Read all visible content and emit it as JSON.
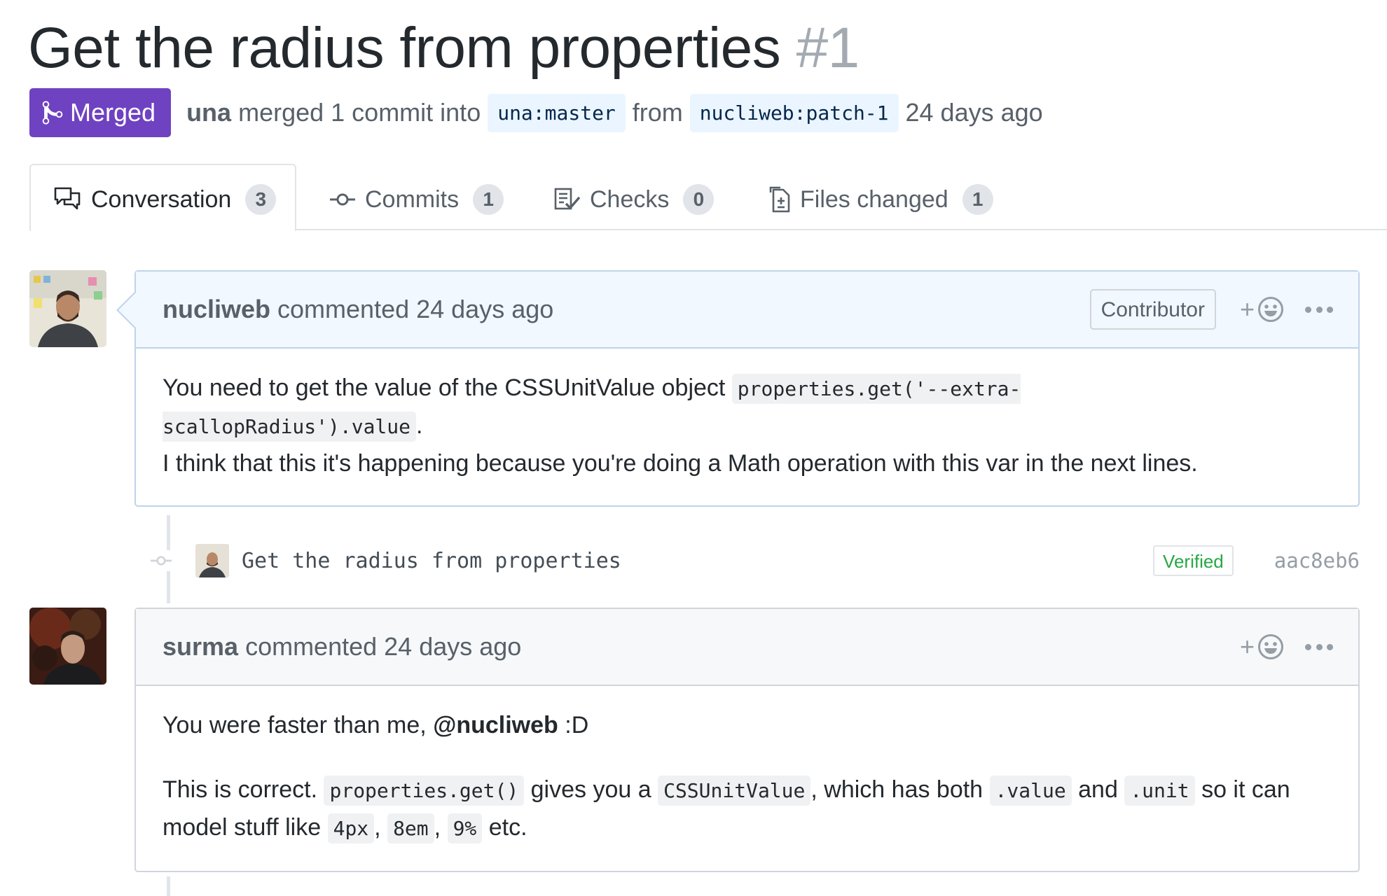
{
  "pr": {
    "title": "Get the radius from properties",
    "number": "#1",
    "state": "Merged",
    "author": "una",
    "action_text": "merged 1 commit into",
    "base_branch": "una:master",
    "from_text": "from",
    "head_branch": "nucliweb:patch-1",
    "time": "24 days ago"
  },
  "tabs": [
    {
      "label": "Conversation",
      "count": "3",
      "icon": "comment-discussion-icon"
    },
    {
      "label": "Commits",
      "count": "1",
      "icon": "git-commit-icon"
    },
    {
      "label": "Checks",
      "count": "0",
      "icon": "checklist-icon"
    },
    {
      "label": "Files changed",
      "count": "1",
      "icon": "diff-icon"
    }
  ],
  "comments": [
    {
      "author": "nucliweb",
      "meta": "commented 24 days ago",
      "badge": "Contributor",
      "body": {
        "t1": "You need to get the value of the CSSUnitValue object ",
        "c1": "properties.get('--extra-scallopRadius').value",
        "t2": ".",
        "line2": "I think that this it's happening because you're doing a Math operation with this var in the next lines."
      }
    },
    {
      "author": "surma",
      "meta": "commented 24 days ago",
      "body": {
        "p1_text": "You were faster than me, ",
        "p1_mention": "@nucliweb",
        "p1_end": " :D",
        "p2_t1": "This is correct. ",
        "p2_c1": "properties.get()",
        "p2_t2": " gives you a ",
        "p2_c2": "CSSUnitValue",
        "p2_t3": ", which has both ",
        "p2_c3": ".value",
        "p2_t4": " and ",
        "p2_c4": ".unit",
        "p2_t5": " so it can model stuff like ",
        "p2_c5": "4px",
        "p2_t6": ", ",
        "p2_c6": "8em",
        "p2_t7": ", ",
        "p2_c7": "9%",
        "p2_t8": " etc."
      }
    }
  ],
  "commit": {
    "message": "Get the radius from properties",
    "verified": "Verified",
    "sha": "aac8eb6"
  },
  "colors": {
    "merged": "#6f42c1",
    "verified": "#28a745",
    "branch_bg": "#eaf5ff"
  }
}
